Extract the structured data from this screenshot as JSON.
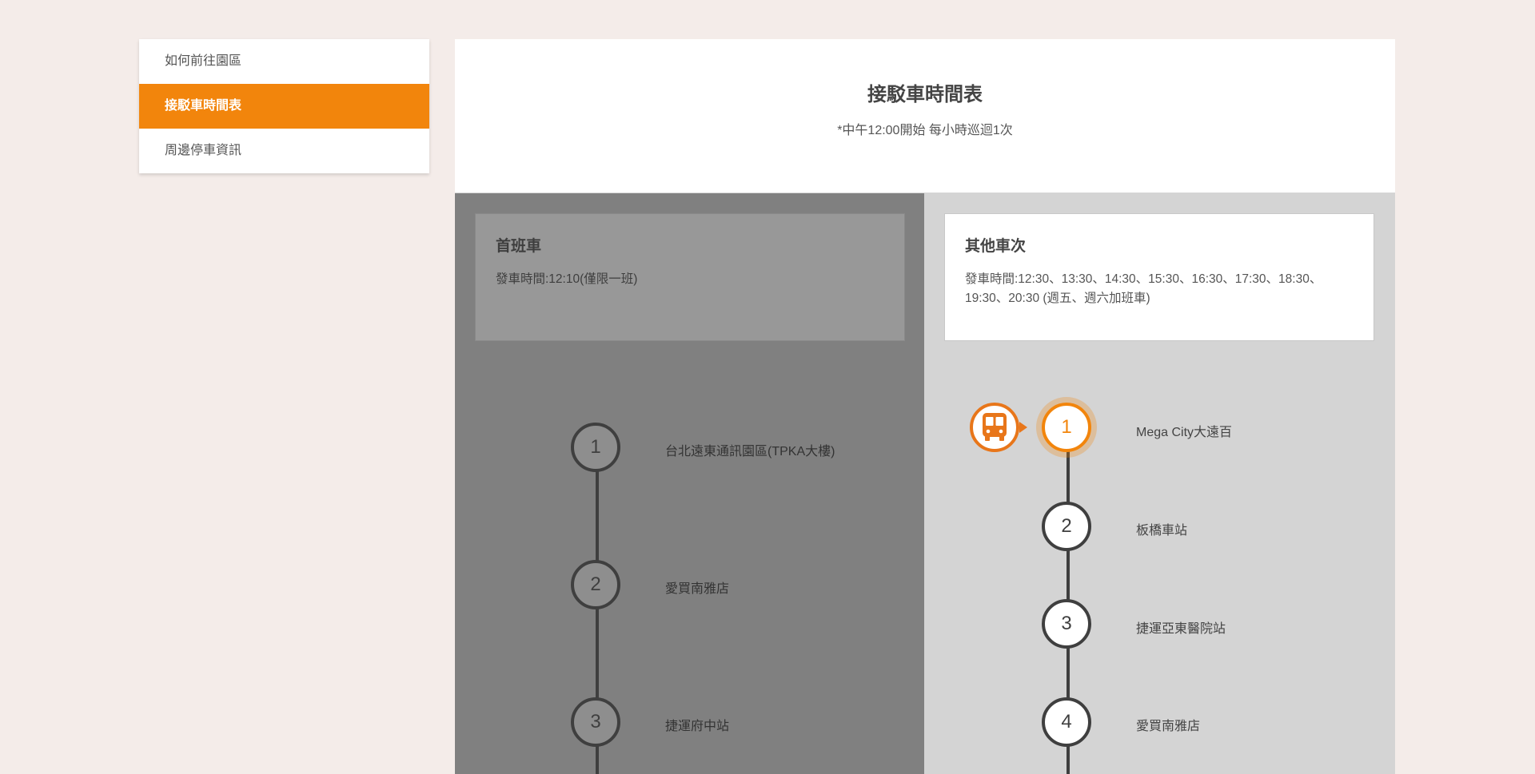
{
  "sidebar": {
    "items": [
      {
        "label": "如何前往園區"
      },
      {
        "label": "接駁車時間表"
      },
      {
        "label": "周邊停車資訊"
      }
    ]
  },
  "header": {
    "title": "接駁車時間表",
    "note": "*中午12:00開始 每小時巡迴1次"
  },
  "first_bus": {
    "title": "首班車",
    "time": "發車時間:12:10(僅限一班)",
    "stops": [
      {
        "num": "1",
        "name": "台北遠東通訊園區(TPKA大樓)"
      },
      {
        "num": "2",
        "name": "愛買南雅店"
      },
      {
        "num": "3",
        "name": "捷運府中站"
      }
    ]
  },
  "other_bus": {
    "title": "其他車次",
    "time": "發車時間:12:30、13:30、14:30、15:30、16:30、17:30、18:30、19:30、20:30 (週五、週六加班車)",
    "stops": [
      {
        "num": "1",
        "name": "Mega City大遠百"
      },
      {
        "num": "2",
        "name": "板橋車站"
      },
      {
        "num": "3",
        "name": "捷運亞東醫院站"
      },
      {
        "num": "4",
        "name": "愛買南雅店"
      }
    ]
  },
  "colors": {
    "accent": "#f2850c",
    "background": "#f4ece9"
  }
}
